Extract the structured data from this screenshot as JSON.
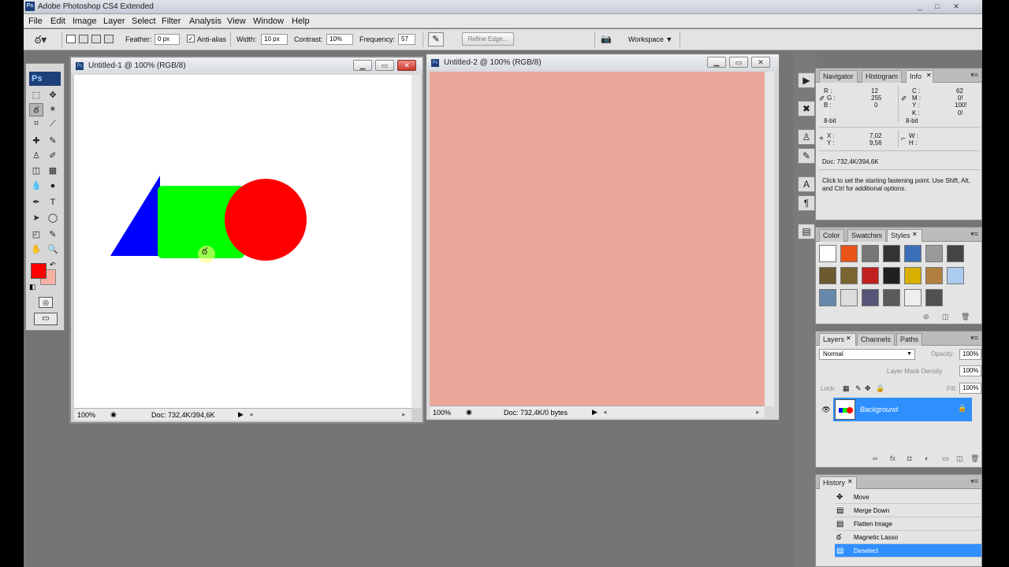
{
  "title_bar": {
    "app_logo": "Ps",
    "title": "Adobe Photoshop CS4 Extended",
    "minimize": "_",
    "restore": "□",
    "close": "✕"
  },
  "menu": [
    "File",
    "Edit",
    "Image",
    "Layer",
    "Select",
    "Filter",
    "Analysis",
    "View",
    "Window",
    "Help"
  ],
  "options_bar": {
    "feather_label": "Feather:",
    "feather_value": "0 px",
    "antialias_check": "✓",
    "antialias_label": "Anti-alias",
    "width_label": "Width:",
    "width_value": "10 px",
    "contrast_label": "Contrast:",
    "contrast_value": "10%",
    "frequency_label": "Frequency:",
    "frequency_value": "57",
    "refine_edge_label": "Refine Edge...",
    "workspace_label": "Workspace ▼"
  },
  "toolbox": {
    "logo": "Ps",
    "foreground_color": "#ff0000",
    "background_color": "#f6b0a4"
  },
  "documents": [
    {
      "title": "Untitled-1 @ 100% (RGB/8)",
      "zoom": "100%",
      "doc_info": "Doc: 732,4K/394,6K",
      "canvas_color": "#ffffff"
    },
    {
      "title": "Untitled-2 @ 100% (RGB/8)",
      "zoom": "100%",
      "doc_info": "Doc: 732,4K/0 bytes",
      "canvas_color": "#eaa89a"
    }
  ],
  "shapes": {
    "triangle_color": "#0000ff",
    "rectangle_color": "#00ff00",
    "circle_color": "#ff0000"
  },
  "info_panel": {
    "tabs": [
      "Navigator",
      "Histogram",
      "Info"
    ],
    "active_tab_close": "✕",
    "rgb": [
      {
        "label": "R :",
        "value": "12"
      },
      {
        "label": "G :",
        "value": "255"
      },
      {
        "label": "B :",
        "value": "0"
      }
    ],
    "cmyk": [
      {
        "label": "C :",
        "value": "62"
      },
      {
        "label": "M :",
        "value": "0!"
      },
      {
        "label": "Y :",
        "value": "100!"
      },
      {
        "label": "K :",
        "value": "0!"
      }
    ],
    "bit_left": "8-bit",
    "bit_right": "8-bit",
    "x_label": "X :",
    "x_value": "7,02",
    "y_label": "Y :",
    "y_value": "9,56",
    "w_label": "W :",
    "h_label": "H :",
    "doc": "Doc: 732,4K/394,6K",
    "hint": "Click to set the starting fastening point.  Use Shift, Alt, and Ctrl for additional options."
  },
  "styles_panel": {
    "tabs": [
      "Color",
      "Swatches",
      "Styles"
    ],
    "active_tab_close": "✕",
    "swatches": [
      "#ffffff",
      "#e8541a",
      "#777777",
      "#333333",
      "#3b6fb8",
      "#9a9a9a",
      "#444444",
      "#6b5a2e",
      "#7a6530",
      "#c02020",
      "#202020",
      "#d9b000",
      "#b08040",
      "#aaccee",
      "#6688aa",
      "#dddddd",
      "#555577",
      "#5a5a5a",
      "#eeeeee",
      "#505050"
    ]
  },
  "layers_panel": {
    "tabs": [
      "Layers",
      "Channels",
      "Paths"
    ],
    "active_tab_close": "✕",
    "blend_mode": "Normal",
    "opacity_label": "Opacity:",
    "opacity_value": "100%",
    "density_label": "Layer Mask Density",
    "density_value": "100%",
    "lock_label": "Lock:",
    "fill_label": "Fill:",
    "fill_value": "100%",
    "layer_name": "Background",
    "eye": "👁",
    "lock_icon": "🔒"
  },
  "history_panel": {
    "tab": "History",
    "tab_close": "✕",
    "items": [
      {
        "icon": "✥",
        "label": "Move"
      },
      {
        "icon": "▤",
        "label": "Merge Down"
      },
      {
        "icon": "▤",
        "label": "Flatten Image"
      },
      {
        "icon": "ఠ",
        "label": "Magnetic Lasso"
      },
      {
        "icon": "▤",
        "label": "Deselect"
      }
    ]
  }
}
